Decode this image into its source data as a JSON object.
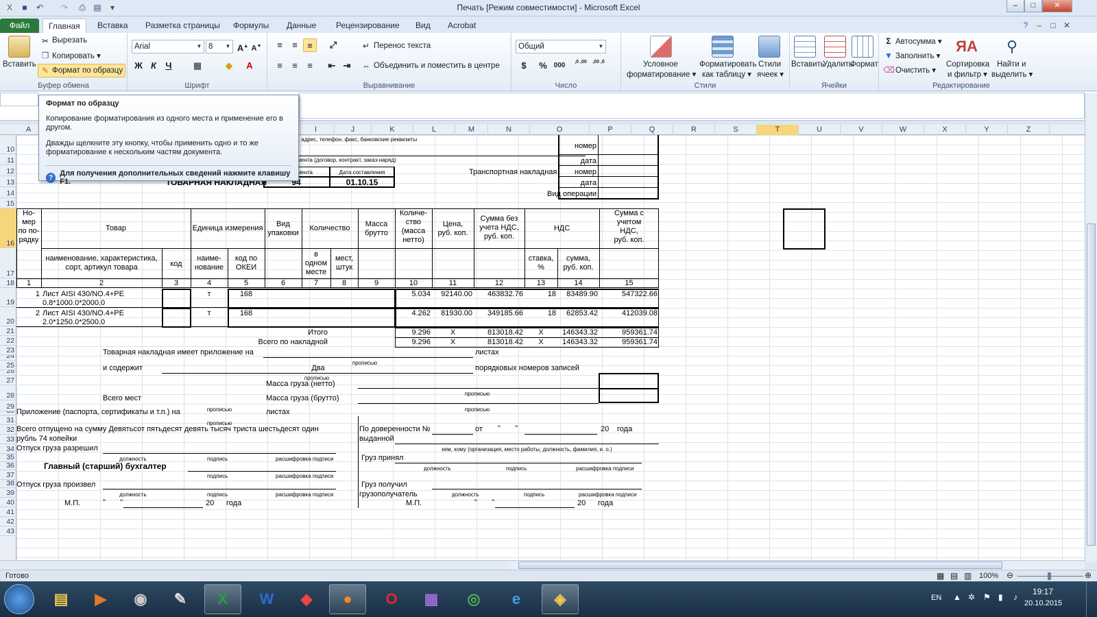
{
  "window": {
    "title": "Печать  [Режим совместимости]  -  Microsoft Excel",
    "min": "–",
    "max": "□",
    "close": "✕"
  },
  "tabs": [
    "Файл",
    "Главная",
    "Вставка",
    "Разметка страницы",
    "Формулы",
    "Данные",
    "Рецензирование",
    "Вид",
    "Acrobat"
  ],
  "ribbon": {
    "clipboard": {
      "paste": "Вставить",
      "cut": "Вырезать",
      "copy": "Копировать ▾",
      "format_painter": "Формат по образцу",
      "name": "Буфер обмена"
    },
    "font": {
      "family": "Arial",
      "size": "8",
      "bold": "Ж",
      "italic": "К",
      "underline": "Ч",
      "name": "Шрифт"
    },
    "align": {
      "wrap": "Перенос текста",
      "merge": "Объединить и поместить в центре",
      "name": "Выравнивание"
    },
    "number": {
      "format": "Общий",
      "name": "Число",
      "currency": "$",
      "percent": "%",
      "thousands": "000",
      "inc_dec": ",0 ,00",
      "dec_dec": ",00 ,0"
    },
    "styles": {
      "cond1": "Условное",
      "cond2": "форматирование ▾",
      "table1": "Форматировать",
      "table2": "как таблицу ▾",
      "cell1": "Стили",
      "cell2": "ячеек ▾",
      "name": "Стили"
    },
    "cells": {
      "insert": "Вставить",
      "delete": "Удалить",
      "format": "Формат",
      "name": "Ячейки"
    },
    "editing": {
      "autosum": "Автосумма ▾",
      "fill": "Заполнить ▾",
      "clear": "Очистить ▾",
      "sort1": "Сортировка",
      "sort2": "и фильтр ▾",
      "find1": "Найти и",
      "find2": "выделить ▾",
      "name": "Редактирование"
    }
  },
  "tooltip": {
    "title": "Формат по образцу",
    "p1": "Копирование форматирования из одного места и применение его в другом.",
    "p2": "Дважды щелкните эту кнопку, чтобы применить одно и то же форматирование к нескольким частям документа.",
    "help": "Для получения дополнительных сведений нажмите клавишу F1."
  },
  "columns": [
    "A",
    "B",
    "C",
    "D",
    "E",
    "F",
    "G",
    "H",
    "I",
    "J",
    "K",
    "L",
    "M",
    "N",
    "O",
    "P",
    "Q",
    "R",
    "S",
    "T",
    "U",
    "V",
    "W",
    "X",
    "Y",
    "Z"
  ],
  "rows": [
    "10",
    "11",
    "12",
    "13",
    "14",
    "15",
    "16",
    "17",
    "18",
    "19",
    "20",
    "21",
    "22",
    "23",
    "24",
    "25",
    "26",
    "27",
    "28",
    "29",
    "30",
    "31",
    "32",
    "33",
    "34",
    "35",
    "36",
    "37",
    "38",
    "39",
    "40",
    "41",
    "42",
    "43"
  ],
  "sheet": {
    "r10_req": "ия,  адрес, телефон,  факс, банковские реквизиты",
    "nomer": "номер",
    "data": "дата",
    "r11_basis": "кумента (договор, контракт, заказ-наряд)",
    "hdr_doc": "кумента",
    "hdr_date": "Дата составления",
    "transport": "Транспортная накладная",
    "title": "ТОВАРНАЯ НАКЛАДНАЯ",
    "doc_no": "94",
    "doc_date": "01.10.15",
    "vid_oper": "Вид операции",
    "h_num": "Но-\nмер\nпо по-\nрядку",
    "h_tovar": "Товар",
    "h_unit": "Единица измерения",
    "h_pack": "Вид\nупаковки",
    "h_qty": "Количество",
    "h_mass": "Масса\nбрутто",
    "h_qtynet": "Количе-\nство\n(масса\nнетто)",
    "h_price": "Цена,\nруб. коп.",
    "h_sumnovat": "Сумма без\nучета НДС,\nруб. коп.",
    "h_vat": "НДС",
    "h_sumvat": "Сумма с\nучетом\nНДС,\nруб. коп.",
    "h_name": "наименование, характеристика,\nсорт, артикул товара",
    "h_code": "код",
    "h_uname": "наиме-\nнование",
    "h_okei": "код по\nОКЕИ",
    "h_inone": "в\nодном\nместе",
    "h_places": "мест,\nштук",
    "h_rate": "ставка,\n%",
    "h_vatsum": "сумма,\nруб. коп.",
    "nums": [
      "1",
      "2",
      "3",
      "4",
      "5",
      "6",
      "7",
      "8",
      "9",
      "10",
      "11",
      "12",
      "13",
      "14",
      "15"
    ],
    "items": [
      {
        "n": "1",
        "name1": "Лист AISI 430/NO.4+PE",
        "name2": "0.8*1000.0*2000.0",
        "unit": "т",
        "okei": "168",
        "qty": "5.034",
        "price": "92140.00",
        "sum": "463832.76",
        "rate": "18",
        "vat": "83489.90",
        "total": "547322.66"
      },
      {
        "n": "2",
        "name1": "Лист AISI 430/NO.4+PE",
        "name2": "2.0*1250.0*2500.0",
        "unit": "т",
        "okei": "168",
        "qty": "4.262",
        "price": "81930.00",
        "sum": "349185.66",
        "rate": "18",
        "vat": "62853.42",
        "total": "412039.08"
      }
    ],
    "itogo": "Итого",
    "itogo_qty": "9.296",
    "x": "X",
    "itogo_sum": "813018.42",
    "itogo_vat": "146343.32",
    "itogo_total": "959361.74",
    "vsego": "Всего по накладной",
    "prilozh": "Товарная накладная имеет приложение на",
    "listah": "листах",
    "propisyu": "прописью",
    "soderzhit": "и содержит",
    "dva": "Два",
    "poryad": "порядковых номеров записей",
    "massa_net": "Масса груза (нетто)",
    "massa_br": "Масса груза (брутто)",
    "vsego_mest": "Всего мест",
    "pril2": "Приложение (паспорта, сертификаты и т.п.) на",
    "otpusheno": "Всего отпущено на сумму  Девятьсот пятьдесят девять тысяч триста шестьдесят один",
    "rubl": "рубль 74 копейки",
    "doverennost": "По доверенности №",
    "ot": "от",
    "quotes": "\"       \"",
    "god20": "20",
    "goda": "года",
    "vydannoy": "выданной",
    "kem": "кем, кому (организация, место работы, должность, фамилия, и. о.)",
    "razreshil": "Отпуск груза разрешил",
    "dolzh": "должность",
    "podpis": "подпись",
    "rasshifr": "расшифровка  подписи",
    "gruz_prinyal": "Груз принял",
    "buh": "Главный (старший) бухгалтер",
    "proizvel": "Отпуск груза произвел",
    "poluchil": "Груз получил",
    "gruzopol": "грузополучатель",
    "mp": "М.П."
  },
  "status": {
    "ready": "Готово",
    "zoom": "100%"
  },
  "taskbar": {
    "lang": "EN",
    "time": "19:17",
    "date": "20.10.2015"
  }
}
